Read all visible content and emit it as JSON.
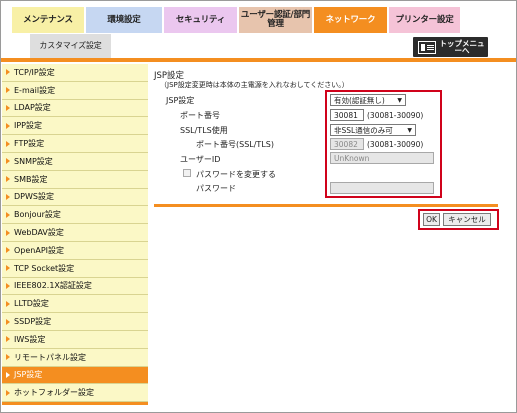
{
  "tabs": {
    "maintenance": "メンテナンス",
    "environment": "環境設定",
    "security": "セキュリティ",
    "user_auth": "ユーザー認証/部門管理",
    "network": "ネットワーク",
    "printer": "プリンター設定",
    "customize": "カスタマイズ設定"
  },
  "top_menu": {
    "label": "トップメニューへ"
  },
  "sidebar": {
    "items": [
      {
        "label": "TCP/IP設定"
      },
      {
        "label": "E-mail設定"
      },
      {
        "label": "LDAP設定"
      },
      {
        "label": "IPP設定"
      },
      {
        "label": "FTP設定"
      },
      {
        "label": "SNMP設定"
      },
      {
        "label": "SMB設定"
      },
      {
        "label": "DPWS設定"
      },
      {
        "label": "Bonjour設定"
      },
      {
        "label": "WebDAV設定"
      },
      {
        "label": "OpenAPI設定"
      },
      {
        "label": "TCP Socket設定"
      },
      {
        "label": "IEEE802.1X認証設定"
      },
      {
        "label": "LLTD設定"
      },
      {
        "label": "SSDP設定"
      },
      {
        "label": "IWS設定"
      },
      {
        "label": "リモートパネル設定"
      },
      {
        "label": "JSP設定",
        "active": true
      },
      {
        "label": "ホットフォルダー設定"
      }
    ]
  },
  "main": {
    "heading": "JSP設定",
    "note": "（JSP設定変更時は本体の主電源を入れなおしてください。）",
    "jsp_label": "JSP設定",
    "jsp_value": "有効(認証無し)",
    "port_label": "ポート番号",
    "port_value": "30081",
    "port_range": "(30081-30090)",
    "ssl_label": "SSL/TLS使用",
    "ssl_value": "非SSL通信のみ可",
    "ssl_port_label": "ポート番号(SSL/TLS)",
    "ssl_port_value": "30082",
    "ssl_port_range": "(30081-30090)",
    "userid_label": "ユーザーID",
    "userid_value": "UnKnown",
    "change_pw_label": "パスワードを変更する",
    "password_label": "パスワード",
    "password_value": "",
    "ok_label": "OK",
    "cancel_label": "キャンセル"
  },
  "colors": {
    "accent": "#f48e20",
    "highlight": "#d0021b",
    "sidebar_bg": "#fbf8c6"
  }
}
